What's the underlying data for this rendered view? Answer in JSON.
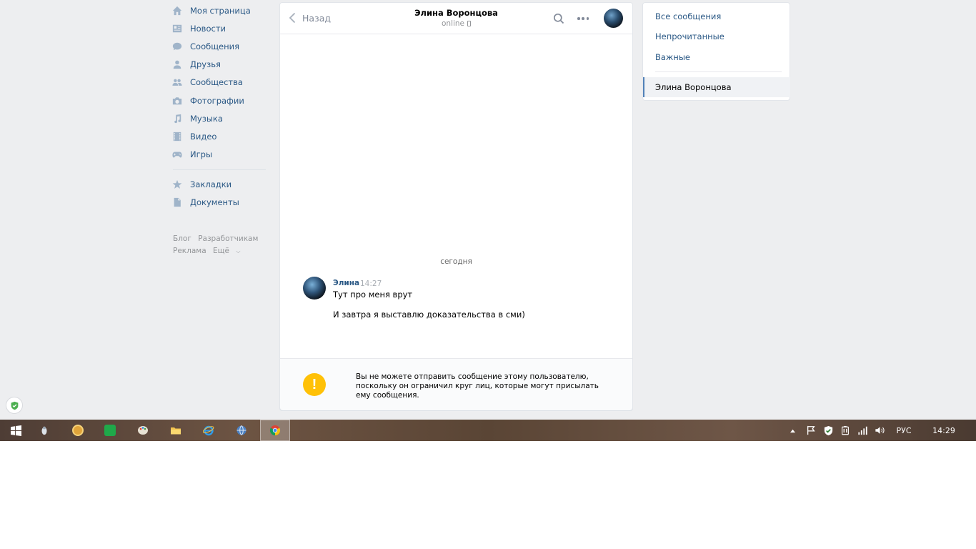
{
  "leftnav": {
    "items": [
      {
        "label": "Моя страница",
        "icon": "home-icon"
      },
      {
        "label": "Новости",
        "icon": "news-icon"
      },
      {
        "label": "Сообщения",
        "icon": "messages-icon"
      },
      {
        "label": "Друзья",
        "icon": "friends-icon"
      },
      {
        "label": "Сообщества",
        "icon": "communities-icon"
      },
      {
        "label": "Фотографии",
        "icon": "camera-icon"
      },
      {
        "label": "Музыка",
        "icon": "music-icon"
      },
      {
        "label": "Видео",
        "icon": "video-icon"
      },
      {
        "label": "Игры",
        "icon": "gamepad-icon"
      }
    ],
    "items2": [
      {
        "label": "Закладки",
        "icon": "star-icon"
      },
      {
        "label": "Документы",
        "icon": "document-icon"
      }
    ],
    "footer": {
      "blog": "Блог",
      "developers": "Разработчикам",
      "ads": "Реклама",
      "more": "Ещё"
    }
  },
  "chat": {
    "back_label": "Назад",
    "peer_name": "Элина Воронцова",
    "peer_status": "online",
    "date_separator": "сегодня",
    "message": {
      "author": "Элина",
      "time": "14:27",
      "line1": "Тут про меня врут",
      "line2": "И завтра я выставлю доказательства в сми)"
    },
    "warning_text": "Вы не можете отправить сообщение этому пользователю, поскольку он ограничил круг лиц, которые могут присылать ему сообщения.",
    "warning_icon": "!"
  },
  "filters": {
    "all": "Все сообщения",
    "unread": "Непрочитанные",
    "important": "Важные",
    "active_conversation": "Элина Воронцова"
  },
  "taskbar": {
    "language": "РУС",
    "clock": "14:29"
  },
  "colors": {
    "page_bg": "#edeef0",
    "link": "#2a5885",
    "accent": "#5181b8",
    "warning": "#ffc107"
  }
}
